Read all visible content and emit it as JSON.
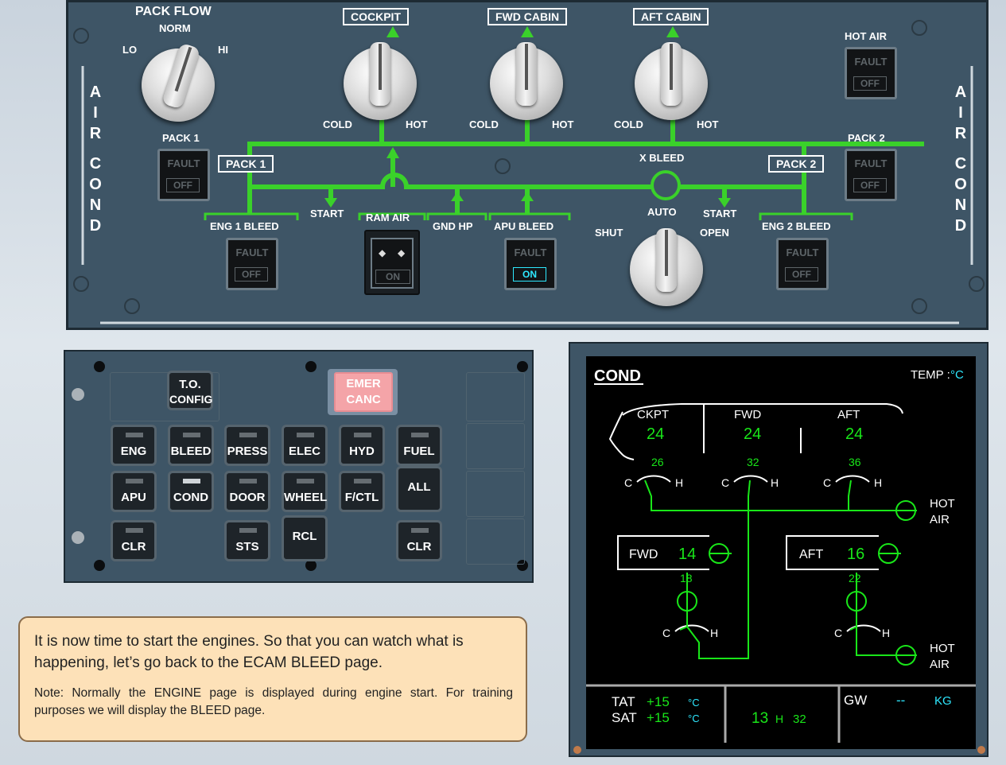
{
  "overhead": {
    "side_label": [
      "A",
      "I",
      "R",
      "C",
      "O",
      "N",
      "D"
    ],
    "pack_flow": {
      "title": "PACK FLOW",
      "norm": "NORM",
      "lo": "LO",
      "hi": "HI"
    },
    "zones": [
      {
        "label": "COCKPIT",
        "cold": "COLD",
        "hot": "HOT"
      },
      {
        "label": "FWD CABIN",
        "cold": "COLD",
        "hot": "HOT"
      },
      {
        "label": "AFT CABIN",
        "cold": "COLD",
        "hot": "HOT"
      }
    ],
    "hot_air": {
      "label": "HOT AIR",
      "fault": "FAULT",
      "state": "OFF"
    },
    "pack1": {
      "label": "PACK 1",
      "box": "PACK 1",
      "fault": "FAULT",
      "state": "OFF"
    },
    "pack2": {
      "label": "PACK 2",
      "box": "PACK 2",
      "fault": "FAULT",
      "state": "OFF"
    },
    "xbleed": {
      "label": "X BLEED",
      "shut": "SHUT",
      "auto": "AUTO",
      "open": "OPEN"
    },
    "start_left": "START",
    "start_right": "START",
    "eng1_bleed": {
      "label": "ENG 1 BLEED",
      "fault": "FAULT",
      "state": "OFF"
    },
    "eng2_bleed": {
      "label": "ENG 2 BLEED",
      "fault": "FAULT",
      "state": "OFF"
    },
    "ram_air": {
      "label": "RAM AIR",
      "state": "ON"
    },
    "gnd_hp": "GND HP",
    "apu_bleed": {
      "label": "APU BLEED",
      "fault": "FAULT",
      "state": "ON"
    }
  },
  "ecp": {
    "to_config": [
      "T.O.",
      "CONFIG"
    ],
    "emer_canc": [
      "EMER",
      "CANC"
    ],
    "row1": [
      "ENG",
      "BLEED",
      "PRESS",
      "ELEC",
      "HYD",
      "FUEL"
    ],
    "row2": [
      "APU",
      "COND",
      "DOOR",
      "WHEEL",
      "F/CTL",
      "ALL"
    ],
    "row3": [
      "CLR",
      "STS",
      "RCL",
      "CLR"
    ]
  },
  "ecam": {
    "title": "COND",
    "temp_label": "TEMP :",
    "temp_unit": "°C",
    "zones": [
      {
        "name": "CKPT",
        "temp": "24",
        "duct": "26"
      },
      {
        "name": "FWD",
        "temp": "24",
        "duct": "32"
      },
      {
        "name": "AFT",
        "temp": "24",
        "duct": "36"
      }
    ],
    "c": "C",
    "h": "H",
    "hot_air": [
      "HOT",
      "AIR"
    ],
    "cargo": [
      {
        "name": "FWD",
        "temp": "14",
        "duct": "18"
      },
      {
        "name": "AFT",
        "temp": "16",
        "duct": "22"
      }
    ],
    "tat_label": "TAT",
    "tat": "+15",
    "sat_label": "SAT",
    "sat": "+15",
    "deg_c": "°C",
    "time_h": "13",
    "time_sep": "H",
    "time_m": "32",
    "gw_label": "GW",
    "gw": "--",
    "gw_unit": "KG"
  },
  "message": {
    "main": "It is now time to start the engines. So that you can watch what is happening, let’s go back to the ECAM BLEED page.",
    "note": "Note: Normally the ENGINE page is displayed during engine start. For training purposes we will display the BLEED page."
  },
  "colors": {
    "panel": "#3e5566",
    "duct": "#3ad12a",
    "ecam_green": "#19e619",
    "ecam_cyan": "#2ee8ff",
    "emer": "#f4a4a8"
  }
}
